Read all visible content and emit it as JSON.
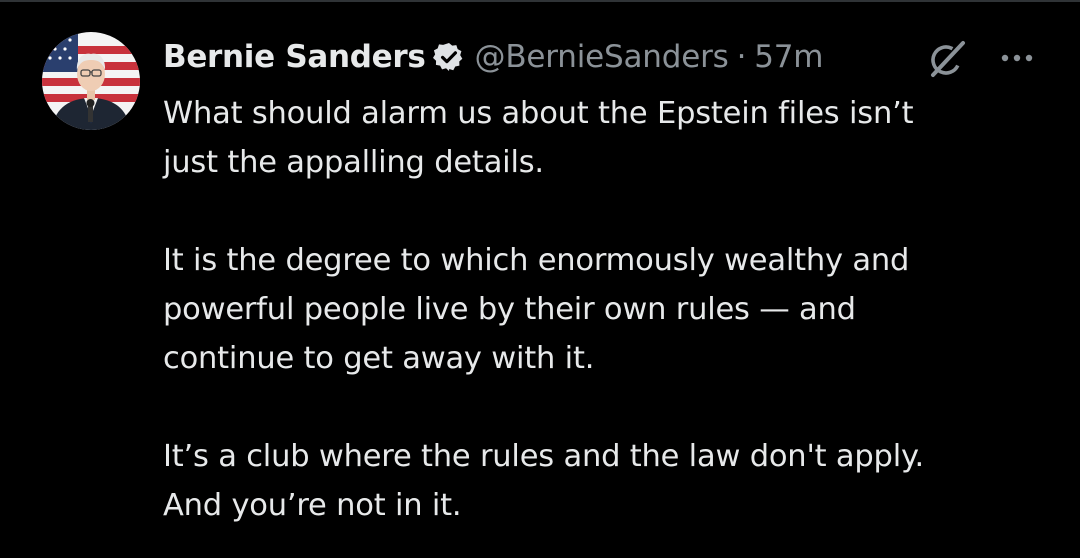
{
  "tweet": {
    "author": {
      "display_name": "Bernie Sanders",
      "handle": "@BernieSanders",
      "verified": true,
      "avatar_icon": "avatar-photo"
    },
    "separator": "·",
    "timestamp": "57m",
    "actions": {
      "grok_icon": "grok-icon",
      "more_icon": "more-icon"
    },
    "paragraphs": [
      {
        "lines": [
          "What should alarm us about the Epstein files isn’t",
          "just the appalling details."
        ]
      },
      {
        "lines": [
          "It is the degree to which enormously wealthy and",
          "powerful people live by their own rules — and",
          "continue to get away with it."
        ]
      },
      {
        "lines": [
          "It’s a club where the rules and the law don't apply.",
          "And you’re not in it."
        ]
      }
    ]
  },
  "colors": {
    "background": "#000000",
    "text_primary": "#e7e9ea",
    "text_secondary": "#8b9298",
    "border": "#2f3336",
    "verified_badge": "#dfe2e5"
  }
}
